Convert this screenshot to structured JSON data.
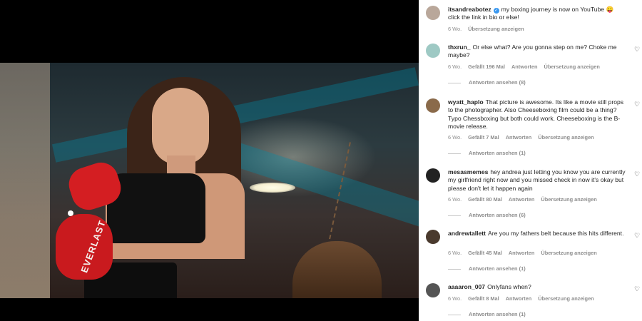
{
  "media": {
    "glove_brand": "EVERLAST"
  },
  "post": {
    "username": "itsandreabotez",
    "verified": true,
    "caption": "my boxing journey is now on YouTube 😛 click the link in bio or else!",
    "age": "6 Wo.",
    "translate": "Übersetzung anzeigen"
  },
  "comments": [
    {
      "username": "thxrun_",
      "text": "Or else what? Are you gonna step on me? Choke me maybe?",
      "age": "6 Wo.",
      "likes": "Gefällt 196 Mal",
      "reply": "Antworten",
      "translate": "Übersetzung anzeigen",
      "view_replies": "Antworten ansehen (8)",
      "avatar_color": "#9ec9c4"
    },
    {
      "username": "wyatt_haplo",
      "text": "That picture is awesome. Its like a movie still props to the photographer. Also Cheeseboxing film could be a thing? Typo Chessboxing but both could work. Cheeseboxing is the B-movie release.",
      "age": "6 Wo.",
      "likes": "Gefällt 7 Mal",
      "reply": "Antworten",
      "translate": "Übersetzung anzeigen",
      "view_replies": "Antworten ansehen (1)",
      "avatar_color": "#8a6a4a"
    },
    {
      "username": "mesasmemes",
      "text": "hey andrea just letting you know you are currently my girlfriend right now and you missed check in now it's okay but please don't let it happen again",
      "age": "6 Wo.",
      "likes": "Gefällt 80 Mal",
      "reply": "Antworten",
      "translate": "Übersetzung anzeigen",
      "view_replies": "Antworten ansehen (6)",
      "avatar_color": "#222222"
    },
    {
      "username": "andrewtallett",
      "text": "Are you my fathers belt because this hits different.",
      "age": "6 Wo.",
      "likes": "Gefällt 45 Mal",
      "reply": "Antworten",
      "translate": "Übersetzung anzeigen",
      "view_replies": "Antworten ansehen (1)",
      "avatar_color": "#4a3a2e"
    },
    {
      "username": "aaaaron_007",
      "text": "Onlyfans when?",
      "age": "6 Wo.",
      "likes": "Gefällt 8 Mal",
      "reply": "Antworten",
      "translate": "Übersetzung anzeigen",
      "view_replies": "Antworten ansehen (1)",
      "avatar_color": "#555555"
    }
  ],
  "icons": {
    "like": "heart-icon",
    "verified": "verified-badge-icon"
  },
  "colors": {
    "verified": "#3897f0",
    "meta": "#8e8e8e",
    "text": "#262626"
  }
}
